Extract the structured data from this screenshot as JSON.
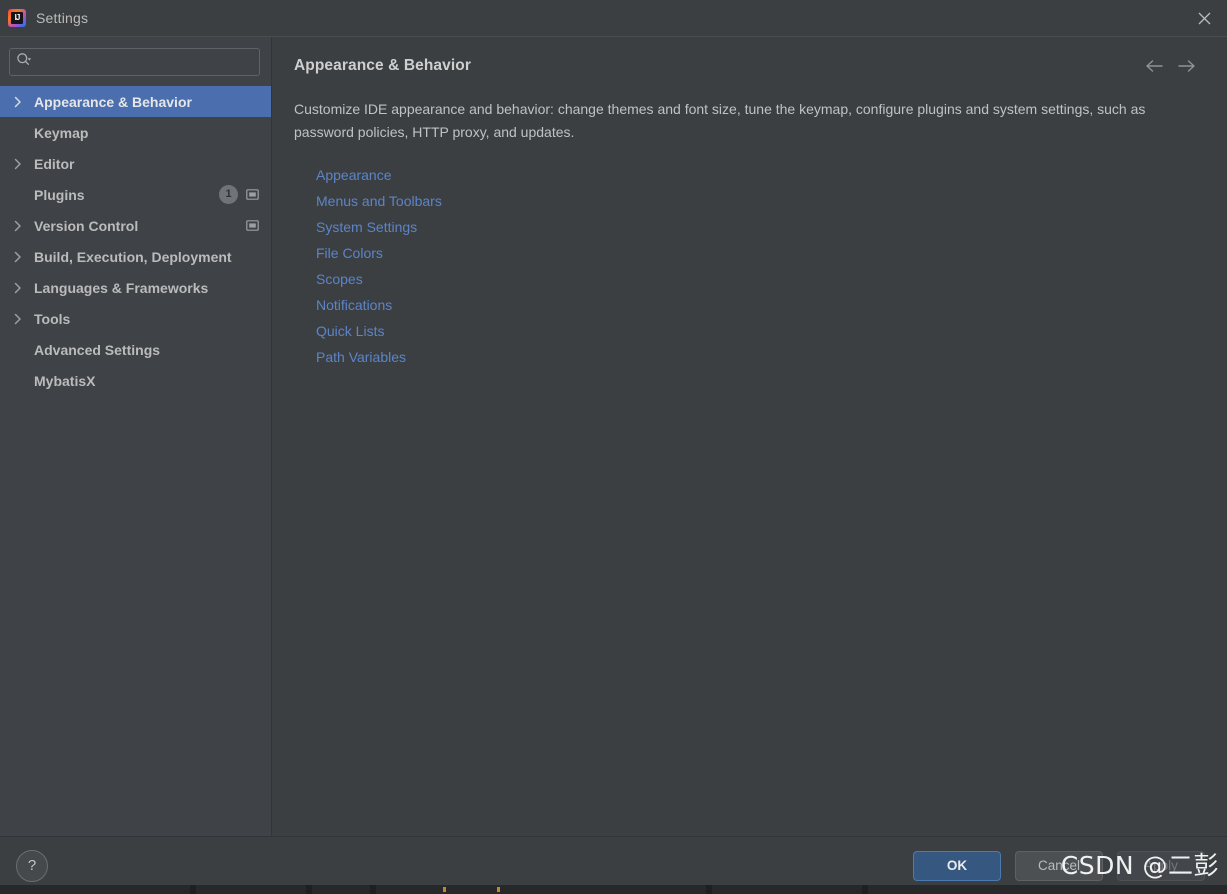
{
  "window": {
    "title": "Settings",
    "app_icon": "intellij-idea-logo",
    "close_icon": "close-icon"
  },
  "search": {
    "placeholder": "",
    "value": "",
    "icon": "search-icon",
    "dropdown_icon": "chevron-down-icon"
  },
  "sidebar": {
    "items": [
      {
        "label": "Appearance & Behavior",
        "expandable": true,
        "selected": true,
        "badge": null,
        "window_icon": false
      },
      {
        "label": "Keymap",
        "expandable": false,
        "selected": false,
        "badge": null,
        "window_icon": false
      },
      {
        "label": "Editor",
        "expandable": true,
        "selected": false,
        "badge": null,
        "window_icon": false
      },
      {
        "label": "Plugins",
        "expandable": false,
        "selected": false,
        "badge": "1",
        "window_icon": true
      },
      {
        "label": "Version Control",
        "expandable": true,
        "selected": false,
        "badge": null,
        "window_icon": true
      },
      {
        "label": "Build, Execution, Deployment",
        "expandable": true,
        "selected": false,
        "badge": null,
        "window_icon": false
      },
      {
        "label": "Languages & Frameworks",
        "expandable": true,
        "selected": false,
        "badge": null,
        "window_icon": false
      },
      {
        "label": "Tools",
        "expandable": true,
        "selected": false,
        "badge": null,
        "window_icon": false
      },
      {
        "label": "Advanced Settings",
        "expandable": false,
        "selected": false,
        "badge": null,
        "window_icon": false
      },
      {
        "label": "MybatisX",
        "expandable": false,
        "selected": false,
        "badge": null,
        "window_icon": false
      }
    ]
  },
  "content": {
    "title": "Appearance & Behavior",
    "description": "Customize IDE appearance and behavior: change themes and font size, tune the keymap, configure plugins and system settings, such as password policies, HTTP proxy, and updates.",
    "back_icon": "arrow-left-icon",
    "forward_icon": "arrow-right-icon",
    "links": [
      "Appearance",
      "Menus and Toolbars",
      "System Settings",
      "File Colors",
      "Scopes",
      "Notifications",
      "Quick Lists",
      "Path Variables"
    ]
  },
  "footer": {
    "help_label": "?",
    "ok_label": "OK",
    "cancel_label": "Cancel",
    "apply_label": "Apply"
  },
  "watermark": {
    "text": "CSDN @二彭"
  },
  "colors": {
    "window_bg": "#3c3f41",
    "sidebar_bg": "#3f4246",
    "selection_blue": "#4b6eaf",
    "link_blue": "#5c84c8",
    "text_primary": "#bbbbbb",
    "ok_button_bg": "#365880"
  }
}
